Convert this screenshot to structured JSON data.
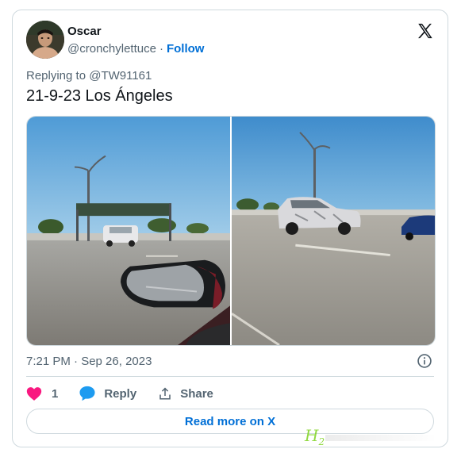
{
  "tweet": {
    "author_name": "Oscar",
    "author_handle": "@cronchylettuce",
    "separator": "·",
    "follow_label": "Follow",
    "replying_prefix": "Replying to ",
    "replying_handle": "@TW91161",
    "text": "21-9-23 Los Ángeles",
    "timestamp": "7:21 PM · Sep 26, 2023",
    "likes_count": "1",
    "reply_label": "Reply",
    "share_label": "Share",
    "read_more_label": "Read more on X"
  },
  "icons": {
    "logo": "x-logo-icon",
    "like": "heart-icon",
    "reply": "speech-bubble-icon",
    "share": "share-upload-icon",
    "info": "info-icon"
  },
  "colors": {
    "link_blue": "#006fd6",
    "like_pink": "#f91880",
    "reply_blue": "#1d9bf0",
    "secondary_text": "#536471",
    "border": "#cfd9de"
  }
}
